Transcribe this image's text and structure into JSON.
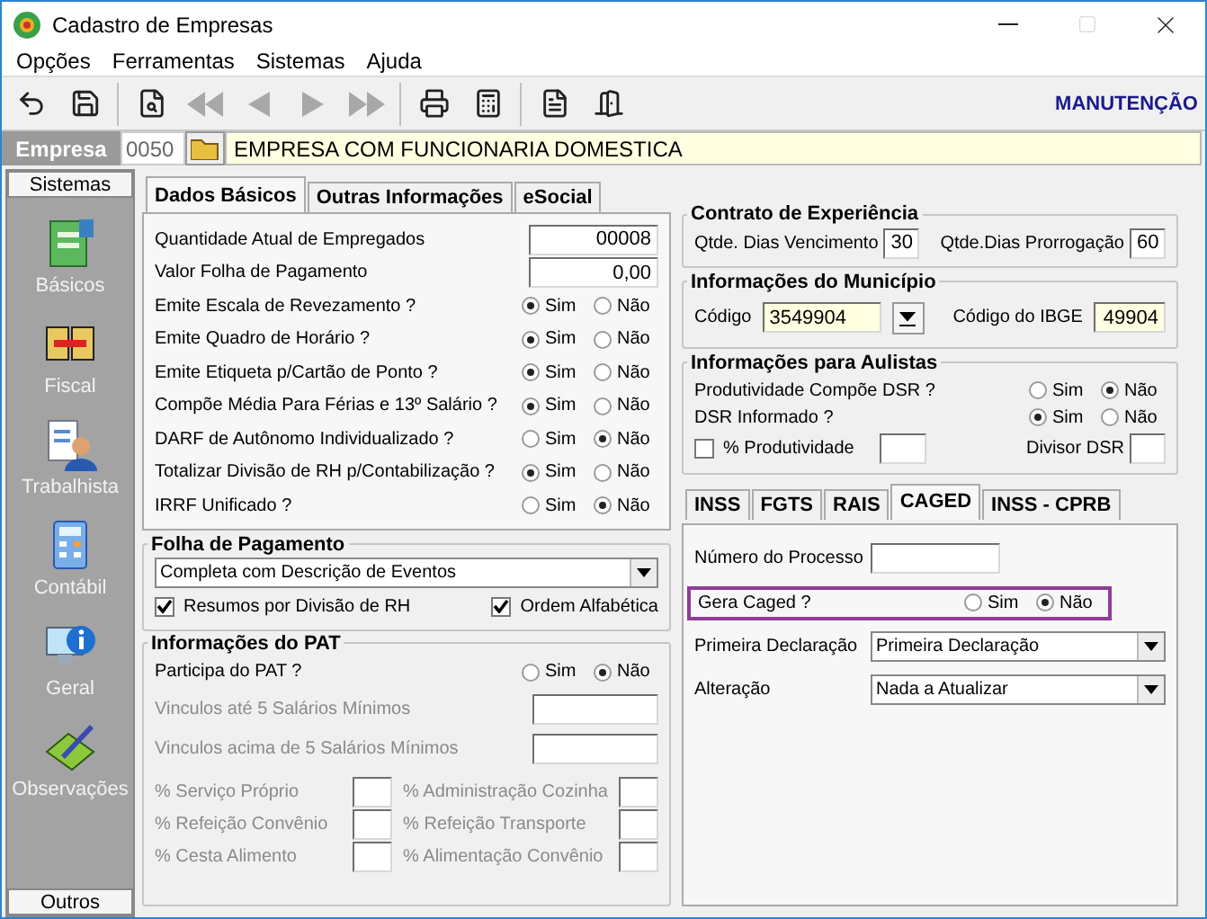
{
  "window": {
    "title": "Cadastro de Empresas"
  },
  "menu": [
    "Opções",
    "Ferramentas",
    "Sistemas",
    "Ajuda"
  ],
  "toolbar": {
    "mode": "MANUTENÇÃO",
    "buttons": [
      {
        "kind": "undo",
        "disabled": false
      },
      {
        "kind": "save",
        "disabled": false
      },
      {
        "kind": "preview",
        "disabled": false
      },
      {
        "kind": "first",
        "disabled": true
      },
      {
        "kind": "prev",
        "disabled": true
      },
      {
        "kind": "next",
        "disabled": true
      },
      {
        "kind": "last",
        "disabled": true
      },
      {
        "kind": "print",
        "disabled": false
      },
      {
        "kind": "calc",
        "disabled": false
      },
      {
        "kind": "report",
        "disabled": false
      },
      {
        "kind": "exit",
        "disabled": false
      }
    ]
  },
  "company": {
    "label": "Empresa",
    "code": "0050",
    "name": "EMPRESA COM FUNCIONARIA DOMESTICA"
  },
  "sidebar": {
    "header": "Sistemas",
    "footer": "Outros",
    "items": [
      {
        "kind": "basics",
        "label": "Básicos"
      },
      {
        "kind": "fiscal",
        "label": "Fiscal"
      },
      {
        "kind": "labor",
        "label": "Trabalhista"
      },
      {
        "kind": "accounting",
        "label": "Contábil"
      },
      {
        "kind": "general",
        "label": "Geral"
      },
      {
        "kind": "notes",
        "label": "Observações"
      }
    ]
  },
  "main_tabs": [
    {
      "label": "Dados Básicos",
      "selected": true
    },
    {
      "label": "Outras Informações",
      "selected": false
    },
    {
      "label": "eSocial",
      "selected": false
    }
  ],
  "basic_fields": [
    {
      "kind": "input",
      "label": "Quantidade Atual de Empregados",
      "value": "00008"
    },
    {
      "kind": "input",
      "label": "Valor Folha de Pagamento",
      "value": "0,00"
    },
    {
      "kind": "radio",
      "label": "Emite Escala de Revezamento ?",
      "options": [
        {
          "label": "Sim",
          "selected": true
        },
        {
          "label": "Não",
          "selected": false
        }
      ]
    },
    {
      "kind": "radio",
      "label": "Emite Quadro de Horário ?",
      "options": [
        {
          "label": "Sim",
          "selected": true
        },
        {
          "label": "Não",
          "selected": false
        }
      ]
    },
    {
      "kind": "radio",
      "label": "Emite Etiqueta p/Cartão de Ponto ?",
      "options": [
        {
          "label": "Sim",
          "selected": true
        },
        {
          "label": "Não",
          "selected": false
        }
      ]
    },
    {
      "kind": "radio",
      "label": "Compõe Média Para Férias e 13º Salário ?",
      "options": [
        {
          "label": "Sim",
          "selected": true
        },
        {
          "label": "Não",
          "selected": false
        }
      ]
    },
    {
      "kind": "radio",
      "label": "DARF de Autônomo Individualizado ?",
      "options": [
        {
          "label": "Sim",
          "selected": false
        },
        {
          "label": "Não",
          "selected": true
        }
      ]
    },
    {
      "kind": "radio",
      "label": "Totalizar Divisão de RH p/Contabilização ?",
      "options": [
        {
          "label": "Sim",
          "selected": true
        },
        {
          "label": "Não",
          "selected": false
        }
      ]
    },
    {
      "kind": "radio",
      "label": "IRRF Unificado ?",
      "options": [
        {
          "label": "Sim",
          "selected": false
        },
        {
          "label": "Não",
          "selected": true
        }
      ]
    }
  ],
  "payroll": {
    "title": "Folha de Pagamento",
    "select": "Completa com Descrição de Eventos",
    "checks": [
      {
        "label": "Resumos por Divisão de RH",
        "checked": true
      },
      {
        "label": "Ordem Alfabética",
        "checked": true
      }
    ]
  },
  "pat": {
    "title": "Informações do PAT",
    "question": {
      "label": "Participa do PAT ?",
      "options": [
        {
          "label": "Sim",
          "selected": false
        },
        {
          "label": "Não",
          "selected": true
        }
      ]
    },
    "fields": [
      {
        "label": "Vinculos até 5 Salários Mínimos",
        "disabled": true
      },
      {
        "label": "Vinculos acima de 5 Salários Mínimos",
        "disabled": true
      }
    ],
    "percent_fields": [
      {
        "label": "% Serviço Próprio",
        "disabled": true
      },
      {
        "label": "% Administração Cozinha",
        "disabled": true
      },
      {
        "label": "% Refeição Convênio",
        "disabled": true
      },
      {
        "label": "% Refeição Transporte",
        "disabled": true
      },
      {
        "label": "% Cesta Alimento",
        "disabled": true
      },
      {
        "label": "% Alimentação Convênio",
        "disabled": true
      }
    ]
  },
  "experience": {
    "title": "Contrato de Experiência",
    "fields": [
      {
        "label": "Qtde. Dias Vencimento",
        "value": "30"
      },
      {
        "label": "Qtde.Dias Prorrogação",
        "value": "60"
      }
    ]
  },
  "municipality": {
    "title": "Informações do Município",
    "code_label": "Código",
    "code": "3549904",
    "ibge_label": "Código do IBGE",
    "ibge": "49904"
  },
  "aulistas": {
    "title": "Informações para Aulistas",
    "questions": [
      {
        "label": "Produtividade Compõe DSR ?",
        "options": [
          {
            "label": "Sim",
            "selected": false
          },
          {
            "label": "Não",
            "selected": true
          }
        ]
      },
      {
        "label": "DSR Informado ?",
        "options": [
          {
            "label": "Sim",
            "selected": true
          },
          {
            "label": "Não",
            "selected": false
          }
        ]
      }
    ],
    "productivity": {
      "label": "% Produtividade",
      "checked": false
    },
    "divisor_label": "Divisor DSR"
  },
  "sub_tabs": [
    {
      "label": "INSS",
      "selected": false
    },
    {
      "label": "FGTS",
      "selected": false
    },
    {
      "label": "RAIS",
      "selected": false
    },
    {
      "label": "CAGED",
      "selected": true
    },
    {
      "label": "INSS - CPRB",
      "selected": false
    }
  ],
  "caged": {
    "process_label": "Número do Processo",
    "question": {
      "label": "Gera Caged ?",
      "highlighted": true,
      "options": [
        {
          "label": "Sim",
          "selected": false
        },
        {
          "label": "Não",
          "selected": true
        }
      ]
    },
    "selects": [
      {
        "label": "Primeira Declaração",
        "value": "Primeira Declaração"
      },
      {
        "label": "Alteração",
        "value": "Nada a Atualizar"
      }
    ]
  }
}
